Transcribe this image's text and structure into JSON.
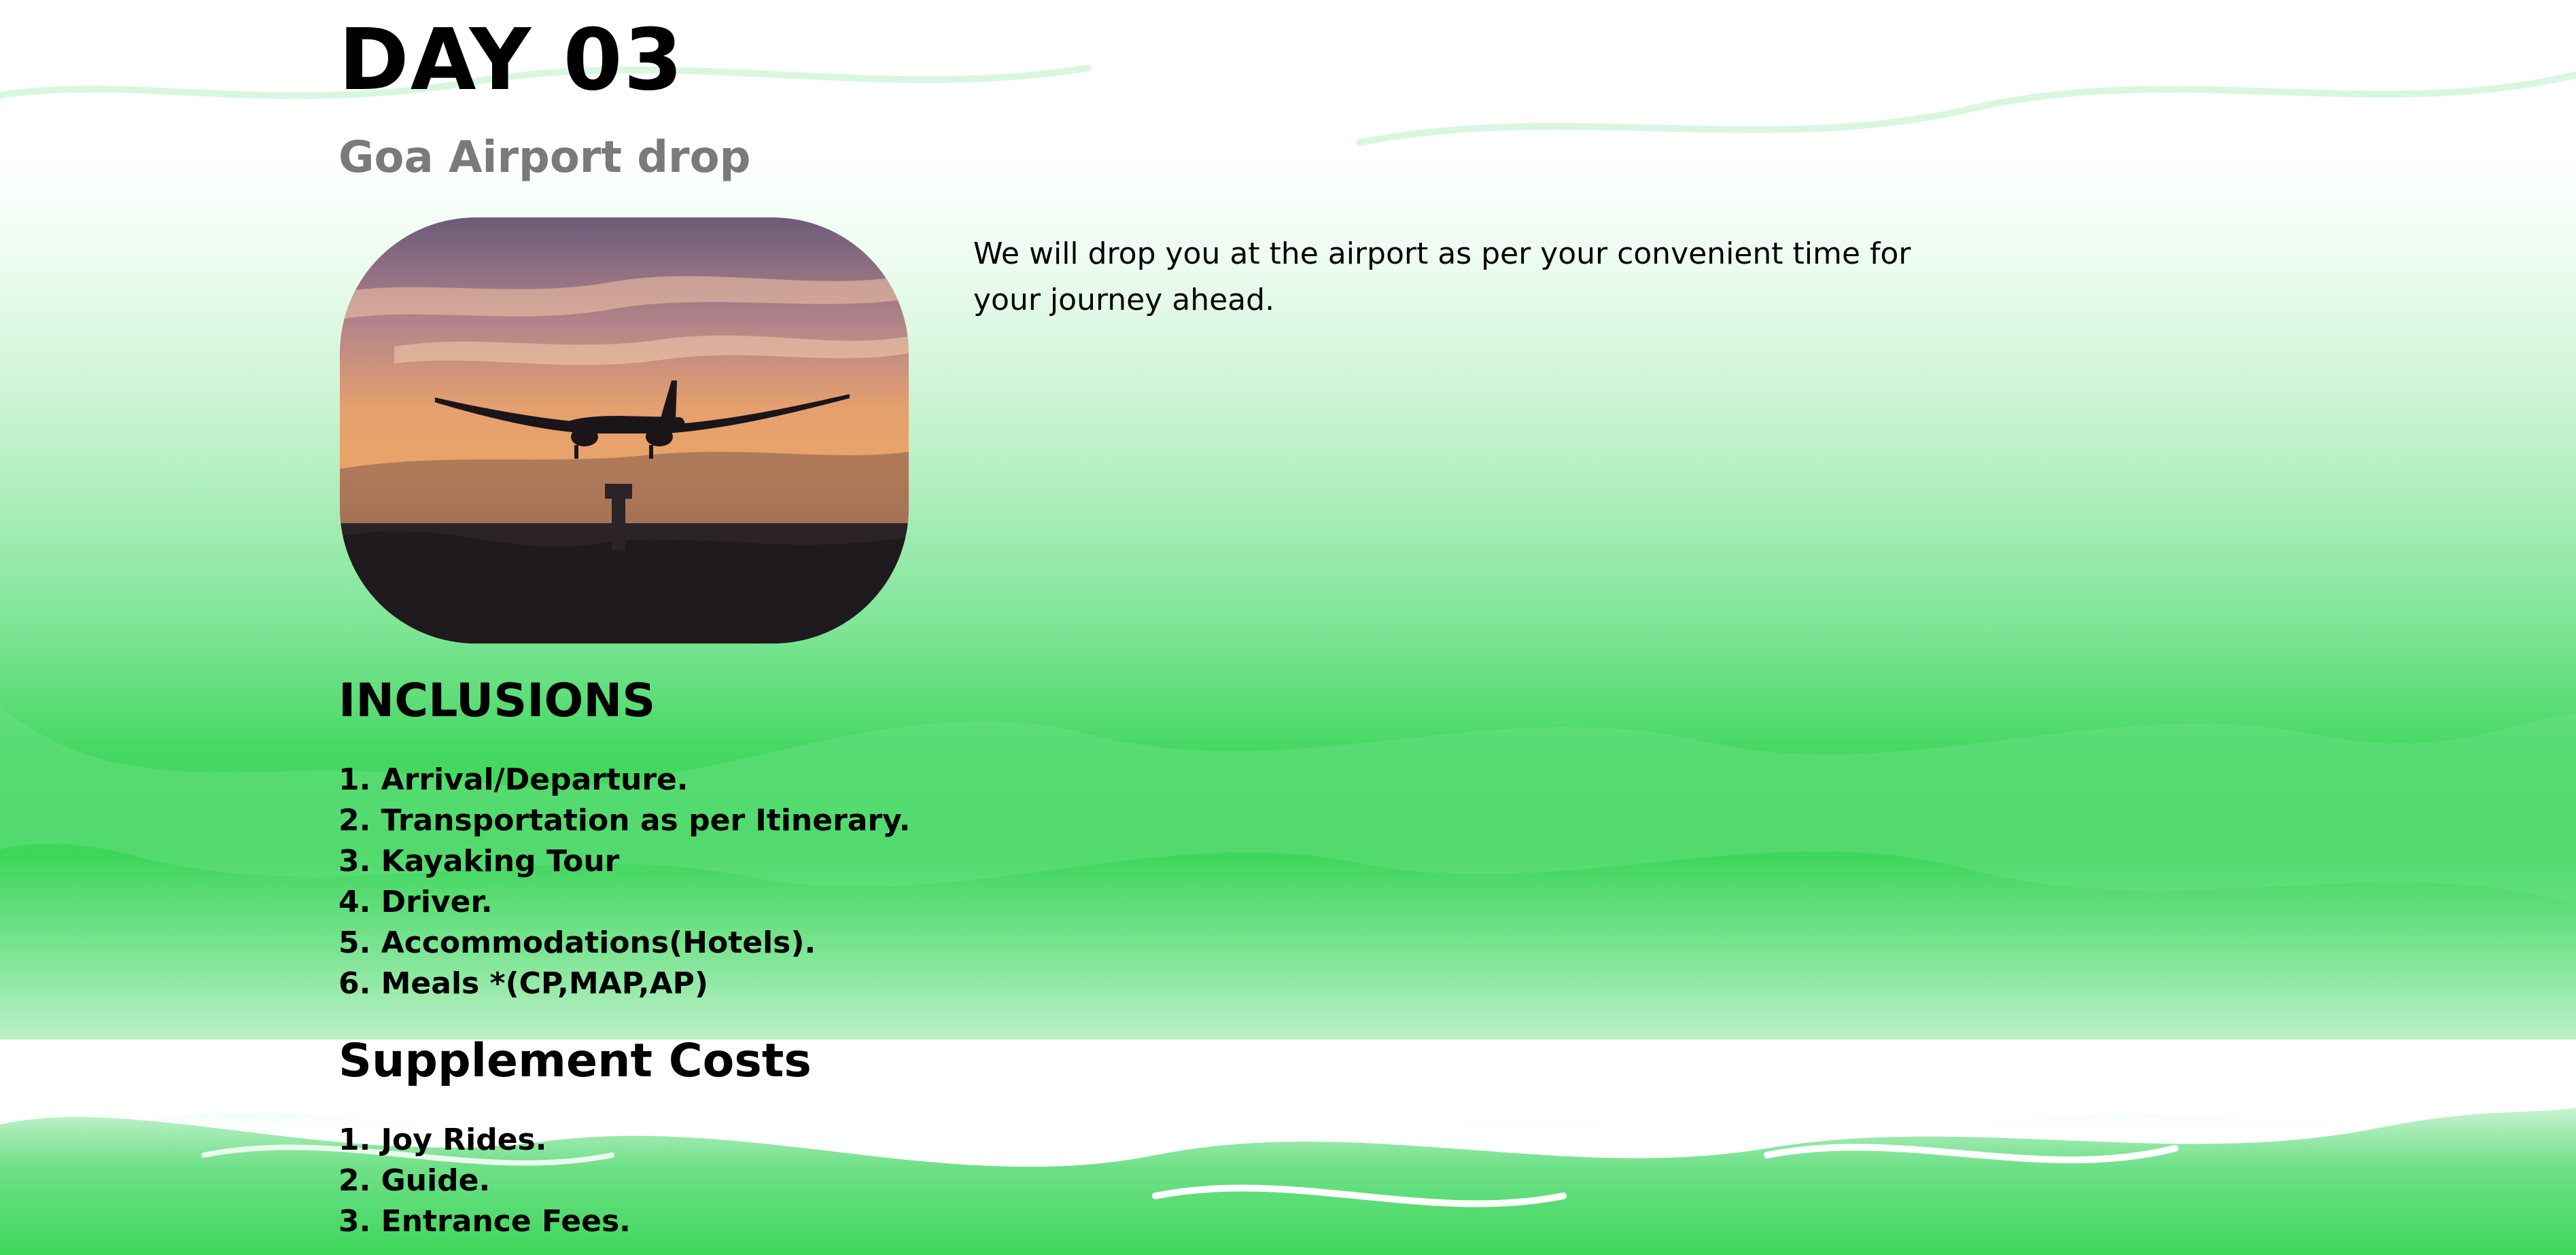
{
  "page": {
    "day_label": "DAY 03",
    "subtitle": "Goa Airport drop",
    "description": "We will drop you at the airport as per your convenient time for your journey ahead.",
    "photo": {
      "icon": "airplane-landing-sunset-photo"
    }
  },
  "inclusions": {
    "heading": "INCLUSIONS",
    "items": [
      "1. Arrival/Departure.",
      "2. Transportation as per Itinerary.",
      "3. Kayaking Tour",
      "4. Driver.",
      "5. Accommodations(Hotels).",
      "6. Meals *(CP,MAP,AP)"
    ]
  },
  "supplements": {
    "heading": "Supplement Costs",
    "items": [
      "1. Joy Rides.",
      "2. Guide.",
      "3. Entrance Fees."
    ]
  },
  "colors": {
    "accent_green": "#3dd65a",
    "light_green": "#c9f3d2",
    "subtitle_gray": "#7a7a7a"
  }
}
